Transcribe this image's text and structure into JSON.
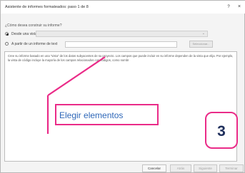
{
  "window": {
    "title": "Asistente de informes formateados: paso 1 de 8",
    "help_label": "?",
    "close_label": "×"
  },
  "question": "¿Cómo desea construir su informe?",
  "options": [
    {
      "label": "Desde una vista",
      "checked": true
    },
    {
      "label": "A partir de un informe de text",
      "checked": false
    }
  ],
  "view_select": {
    "value": ""
  },
  "text_report_input": {
    "value": ""
  },
  "browse_button": {
    "label": "Seleccionar..."
  },
  "description": "Cree su informe basado en una \"vista\" de los datos subyacentes de su proyecto. Los campos que puede incluir en su informe dependen de la vista que elija. Por ejemplo, la vista de código incluye la mayoría de los campos relacionados con códigos, como nombr",
  "callout": {
    "text": "Elegir elementos",
    "border_color": "#ea2b88",
    "text_color": "#2e67b8"
  },
  "step_badge": {
    "number": "3",
    "color": "#1f2f5c"
  },
  "footer": {
    "cancel": "Cancelar",
    "back": "Atrás",
    "next": "Siguiente",
    "finish": "Terminar"
  }
}
